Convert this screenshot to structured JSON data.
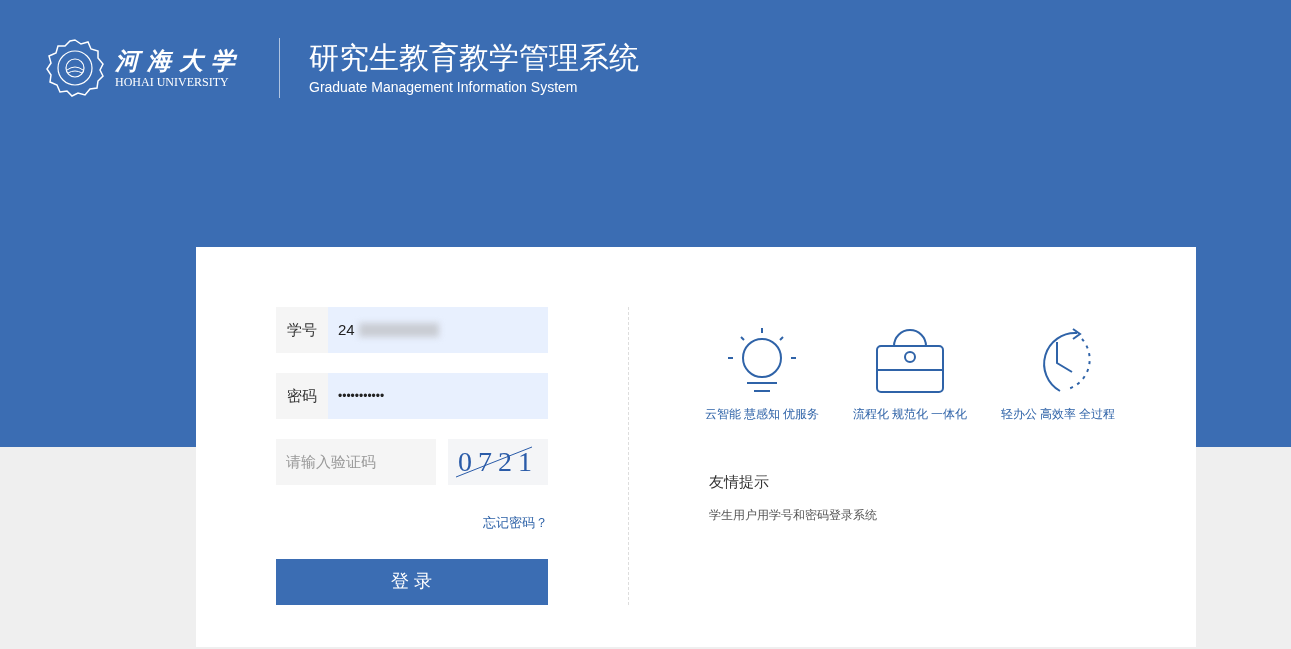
{
  "header": {
    "university_name": "河海大学",
    "university_name_en": "HOHAI UNIVERSITY",
    "title": "研究生教育教学管理系统",
    "subtitle": "Graduate Management Information System"
  },
  "login": {
    "fields": [
      {
        "kind": "text",
        "label": "学号",
        "value": "24",
        "redacted": true
      },
      {
        "kind": "password",
        "label": "密码",
        "value": "•••••••••••",
        "redacted": false
      }
    ],
    "captcha": {
      "placeholder": "请输入验证码",
      "code": "0721"
    },
    "forgot_link": "忘记密码？",
    "submit": "登 录"
  },
  "features": [
    {
      "kind": "bulb",
      "caption": "云智能 慧感知 优服务"
    },
    {
      "kind": "briefcase",
      "caption": "流程化 规范化 一体化"
    },
    {
      "kind": "clock",
      "caption": "轻办公 高效率 全过程"
    }
  ],
  "notice": {
    "title": "友情提示",
    "text": "学生用户用学号和密码登录系统"
  }
}
